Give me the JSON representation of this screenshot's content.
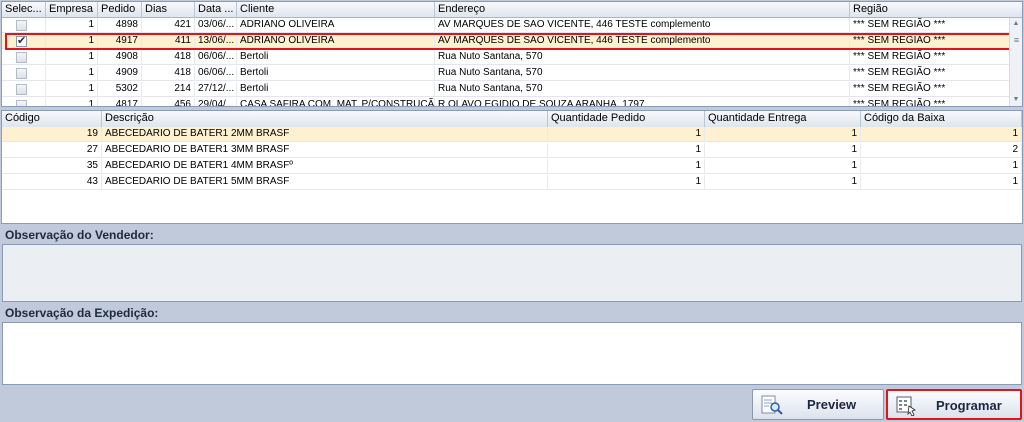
{
  "orders": {
    "columns": [
      {
        "key": "sel",
        "label": "Selec..."
      },
      {
        "key": "empresa",
        "label": "Empresa"
      },
      {
        "key": "pedido",
        "label": "Pedido"
      },
      {
        "key": "dias",
        "label": "Dias"
      },
      {
        "key": "data",
        "label": "Data ..."
      },
      {
        "key": "cliente",
        "label": "Cliente"
      },
      {
        "key": "endereco",
        "label": "Endereço"
      },
      {
        "key": "regiao",
        "label": "Região"
      }
    ],
    "rows": [
      {
        "checked": false,
        "empresa": "1",
        "pedido": "4898",
        "dias": "421",
        "data": "03/06/...",
        "cliente": "ADRIANO OLIVEIRA",
        "endereco": "AV MARQUES DE SAO VICENTE, 446 TESTE complemento",
        "regiao": "*** SEM REGIÃO ***"
      },
      {
        "checked": true,
        "empresa": "1",
        "pedido": "4917",
        "dias": "411",
        "data": "13/06/...",
        "cliente": "ADRIANO OLIVEIRA",
        "endereco": "AV MARQUES DE SAO VICENTE, 446 TESTE complemento",
        "regiao": "*** SEM REGIÃO ***"
      },
      {
        "checked": false,
        "empresa": "1",
        "pedido": "4908",
        "dias": "418",
        "data": "06/06/...",
        "cliente": "Bertoli",
        "endereco": "Rua Nuto Santana, 570",
        "regiao": "*** SEM REGIÃO ***"
      },
      {
        "checked": false,
        "empresa": "1",
        "pedido": "4909",
        "dias": "418",
        "data": "06/06/...",
        "cliente": "Bertoli",
        "endereco": "Rua Nuto Santana, 570",
        "regiao": "*** SEM REGIÃO ***"
      },
      {
        "checked": false,
        "empresa": "1",
        "pedido": "5302",
        "dias": "214",
        "data": "27/12/...",
        "cliente": "Bertoli",
        "endereco": "Rua Nuto Santana, 570",
        "regiao": "*** SEM REGIÃO ***"
      },
      {
        "checked": false,
        "empresa": "1",
        "pedido": "4817",
        "dias": "456",
        "data": "29/04/...",
        "cliente": "CASA SAFIRA COM. MAT. P/CONSTRUÇÃO LTDA",
        "endereco": "R OLAVO EGIDIO DE SOUZA ARANHA, 1797",
        "regiao": "*** SEM REGIÃO ***"
      }
    ]
  },
  "items": {
    "columns": [
      {
        "key": "codigo",
        "label": "Código"
      },
      {
        "key": "descricao",
        "label": "Descrição"
      },
      {
        "key": "qtd_pedido",
        "label": "Quantidade Pedido"
      },
      {
        "key": "qtd_entrega",
        "label": "Quantidade Entrega"
      },
      {
        "key": "cod_baixa",
        "label": "Código da Baixa"
      }
    ],
    "rows": [
      {
        "codigo": "19",
        "descricao": "ABECEDARIO DE BATER1 2MM BRASF",
        "qtd_pedido": "1",
        "qtd_entrega": "1",
        "cod_baixa": "1"
      },
      {
        "codigo": "27",
        "descricao": "ABECEDARIO DE BATER1 3MM BRASF",
        "qtd_pedido": "1",
        "qtd_entrega": "1",
        "cod_baixa": "2"
      },
      {
        "codigo": "35",
        "descricao": "ABECEDARIO DE BATER1 4MM BRASFº",
        "qtd_pedido": "1",
        "qtd_entrega": "1",
        "cod_baixa": "1"
      },
      {
        "codigo": "43",
        "descricao": "ABECEDARIO DE BATER1 5MM BRASF",
        "qtd_pedido": "1",
        "qtd_entrega": "1",
        "cod_baixa": "1"
      }
    ]
  },
  "observations": {
    "vendedor_label": "Observação do Vendedor:",
    "vendedor_value": "",
    "expedicao_label": "Observação da Expedição:",
    "expedicao_value": ""
  },
  "buttons": {
    "preview_label": "Preview",
    "programar_label": "Programar"
  },
  "colors": {
    "selected_row": "#fdf1d0",
    "highlight_border": "#e0151c",
    "background": "#c0cadb"
  }
}
